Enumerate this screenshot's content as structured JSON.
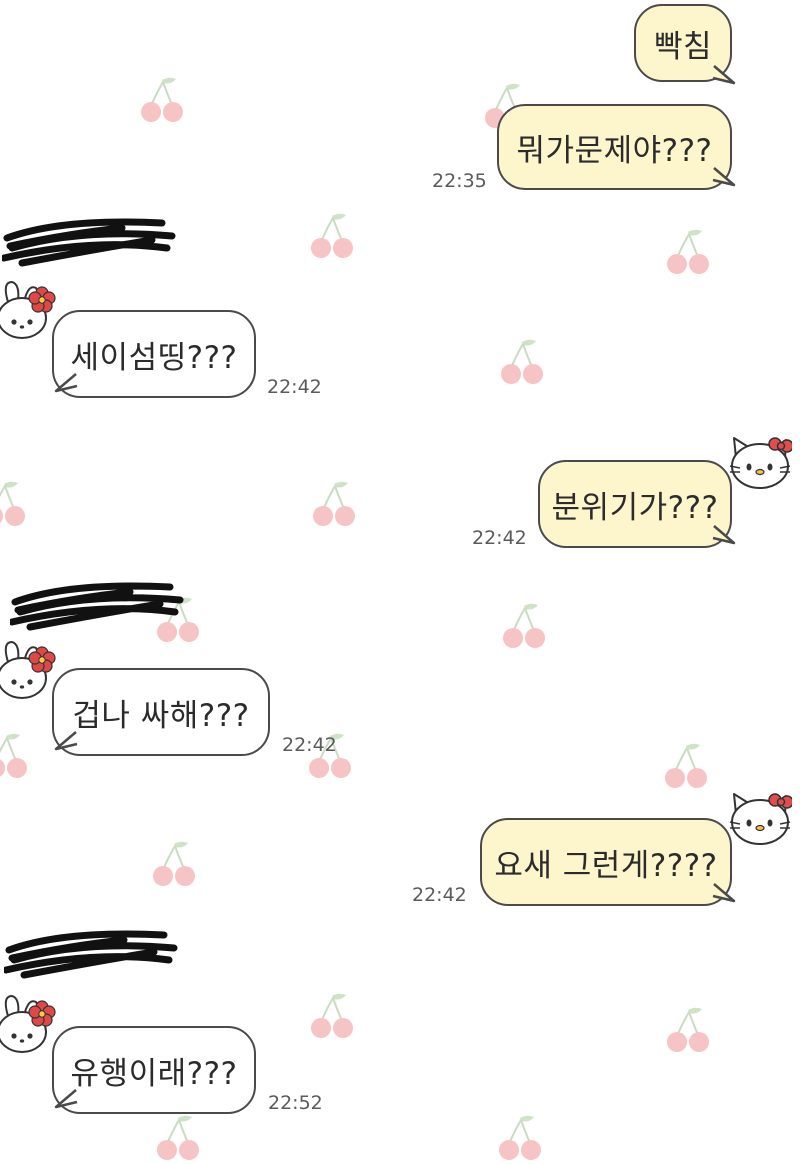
{
  "chat": {
    "messages": [
      {
        "sender": "me",
        "text": "빡침",
        "time": ""
      },
      {
        "sender": "me",
        "text": "뭐가문제야???",
        "time": "22:35"
      },
      {
        "sender": "other",
        "text": "세이섬띵???",
        "time": "22:42"
      },
      {
        "sender": "me",
        "text": "분위기가???",
        "time": "22:42"
      },
      {
        "sender": "other",
        "text": "겁나 싸해???",
        "time": "22:42"
      },
      {
        "sender": "me",
        "text": "요새 그런게????",
        "time": "22:42"
      },
      {
        "sender": "other",
        "text": "유행이래???",
        "time": "22:52"
      }
    ]
  },
  "icons": {
    "background": "cherry-icon",
    "my_avatar": "hello-kitty-avatar-icon",
    "other_avatar": "white-bunny-flower-avatar-icon"
  },
  "colors": {
    "my_bubble": "#fdf5cc",
    "their_bubble": "#ffffff",
    "bubble_border": "#4a4a4a",
    "cherry": "#f2b3b3"
  }
}
